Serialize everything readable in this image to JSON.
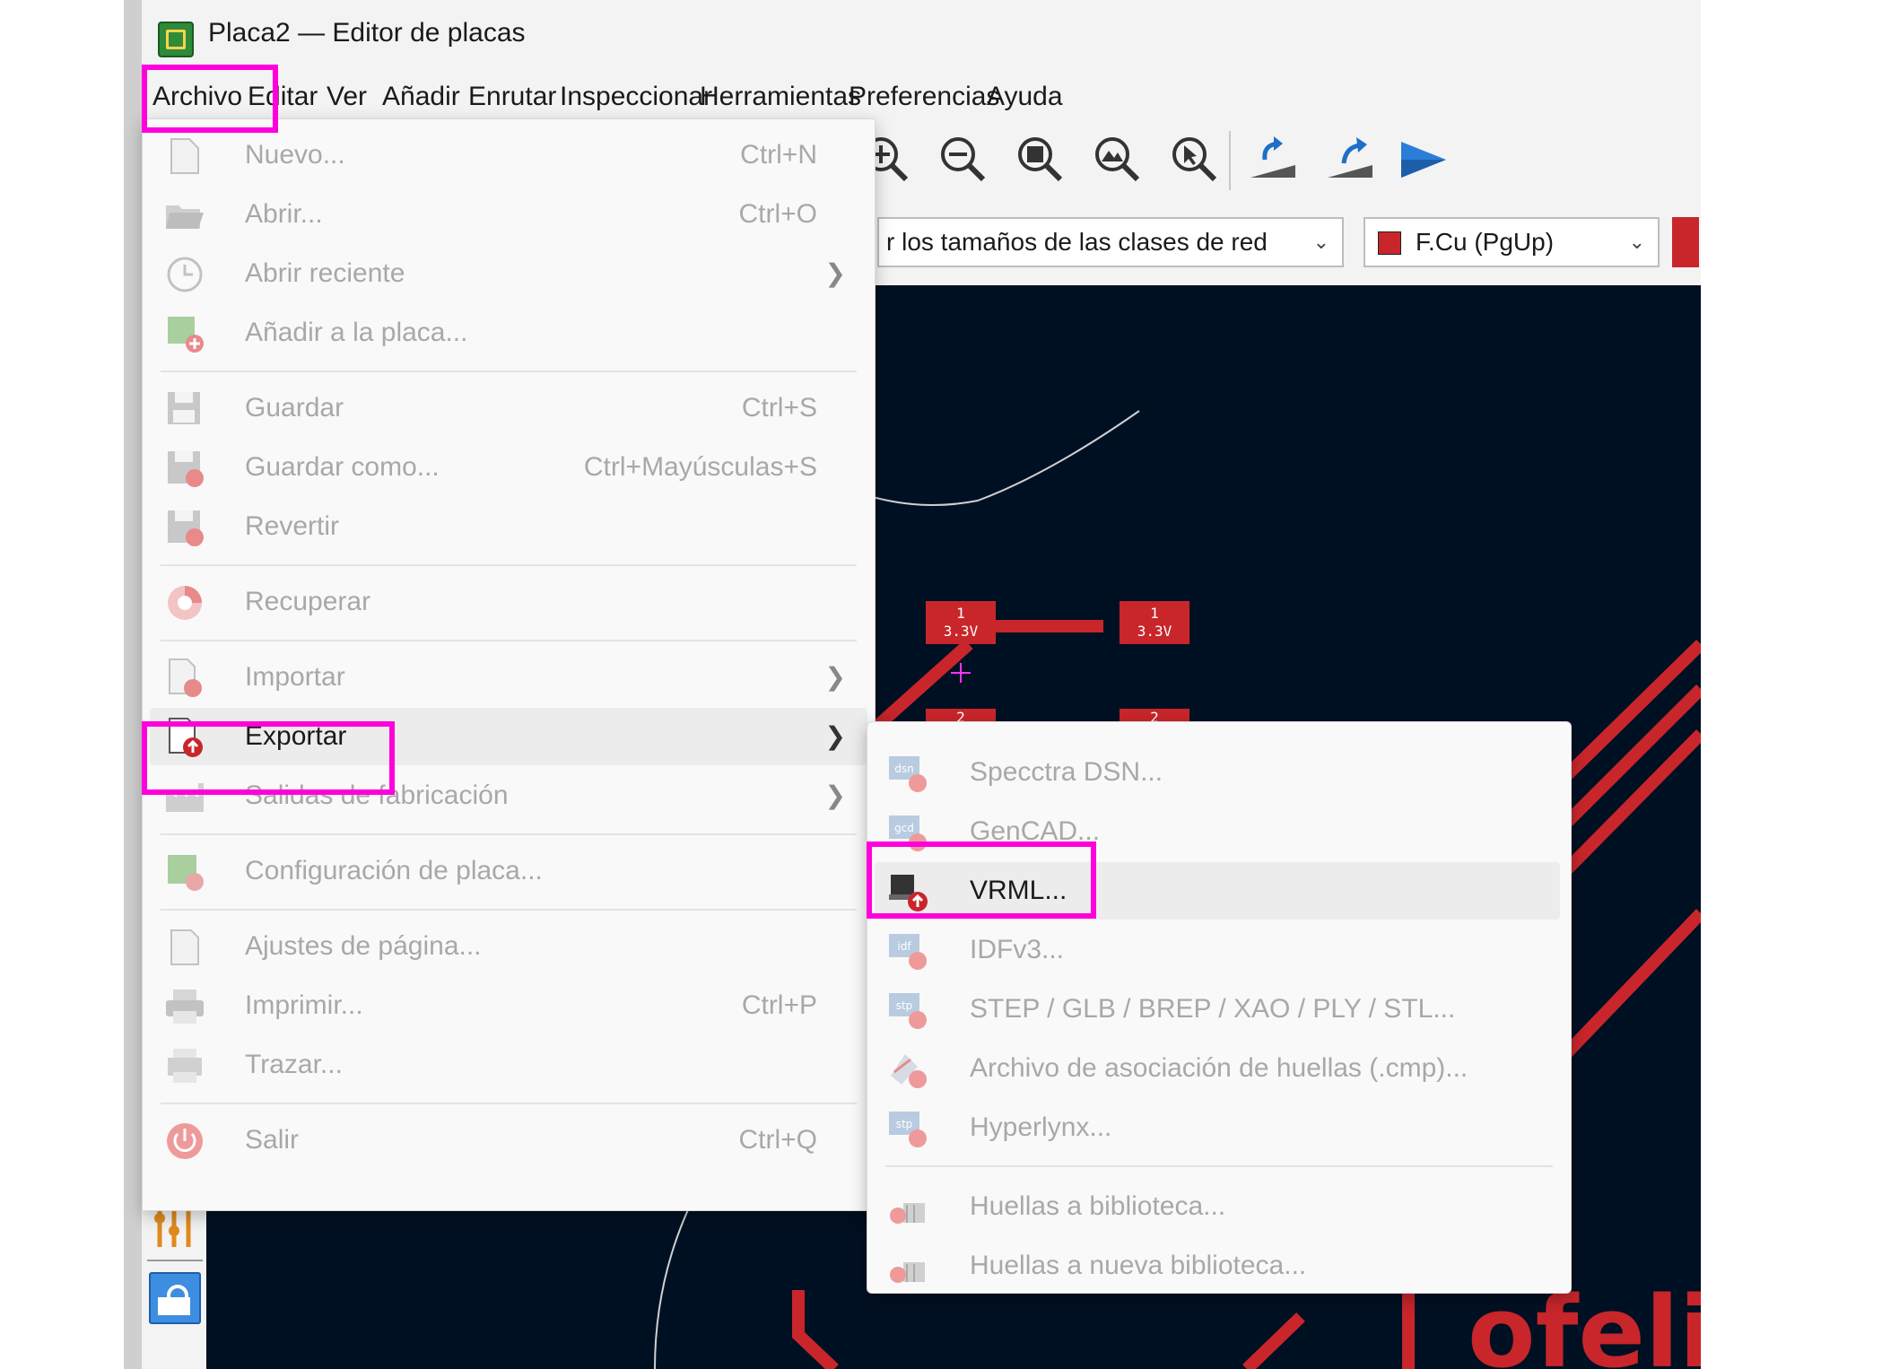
{
  "window": {
    "title": "Placa2 — Editor de placas"
  },
  "menubar": [
    "Archivo",
    "Editar",
    "Ver",
    "Añadir",
    "Enrutar",
    "Inspeccionar",
    "Herramientas",
    "Preferencias",
    "Ayuda"
  ],
  "toolbar": {
    "icons": [
      "find-icon",
      "refresh-icon",
      "zoom-in-icon",
      "zoom-out-icon",
      "zoom-fit-icon",
      "zoom-objects-icon",
      "zoom-selection-icon",
      "flip-board-icon",
      "rotate-icon",
      "play-icon"
    ]
  },
  "combos": {
    "netclass": "r los tamaños de las clases de red",
    "layer": "F.Cu (PgUp)",
    "layer_color": "#c8262b"
  },
  "file_menu": [
    {
      "label": "Nuevo...",
      "shortcut": "Ctrl+N",
      "icon": "new-file-icon",
      "enabled": false
    },
    {
      "label": "Abrir...",
      "shortcut": "Ctrl+O",
      "icon": "folder-icon",
      "enabled": false
    },
    {
      "label": "Abrir reciente",
      "submenu": true,
      "icon": "clock-icon",
      "enabled": false
    },
    {
      "label": "Añadir a la placa...",
      "icon": "add-board-icon",
      "enabled": false
    },
    {
      "label": "Guardar",
      "shortcut": "Ctrl+S",
      "icon": "save-icon",
      "enabled": false
    },
    {
      "label": "Guardar como...",
      "shortcut": "Ctrl+Mayúsculas+S",
      "icon": "save-as-icon",
      "enabled": false
    },
    {
      "label": "Revertir",
      "icon": "revert-icon",
      "enabled": false
    },
    {
      "label": "Recuperar",
      "icon": "recover-icon",
      "enabled": false
    },
    {
      "label": "Importar",
      "submenu": true,
      "icon": "import-icon",
      "enabled": false
    },
    {
      "label": "Exportar",
      "submenu": true,
      "icon": "export-icon",
      "enabled": true
    },
    {
      "label": "Salidas de fabricación",
      "submenu": true,
      "icon": "factory-icon",
      "enabled": false
    },
    {
      "label": "Configuración de placa...",
      "icon": "board-settings-icon",
      "enabled": false
    },
    {
      "label": "Ajustes de página...",
      "icon": "page-settings-icon",
      "enabled": false
    },
    {
      "label": "Imprimir...",
      "shortcut": "Ctrl+P",
      "icon": "print-icon",
      "enabled": false
    },
    {
      "label": "Trazar...",
      "icon": "plot-icon",
      "enabled": false
    },
    {
      "label": "Salir",
      "shortcut": "Ctrl+Q",
      "icon": "power-icon",
      "enabled": false
    }
  ],
  "export_submenu": [
    {
      "label": "Specctra DSN...",
      "icon": "dsn-icon",
      "tag": "dsn",
      "enabled": false
    },
    {
      "label": "GenCAD...",
      "icon": "gencad-icon",
      "tag": "gcd",
      "enabled": false
    },
    {
      "label": "VRML...",
      "icon": "vrml-icon",
      "tag": "",
      "enabled": true
    },
    {
      "label": "IDFv3...",
      "icon": "idf-icon",
      "tag": "idf",
      "enabled": false
    },
    {
      "label": "STEP / GLB / BREP / XAO / PLY / STL...",
      "icon": "step-icon",
      "tag": "stp",
      "enabled": false
    },
    {
      "label": "Archivo de asociación de huellas (.cmp)...",
      "icon": "cmp-icon",
      "tag": "",
      "enabled": false
    },
    {
      "label": "Hyperlynx...",
      "icon": "hyperlynx-icon",
      "tag": "stp",
      "enabled": false
    },
    {
      "label": "Huellas a biblioteca...",
      "icon": "footprint-lib-icon",
      "tag": "",
      "enabled": false
    },
    {
      "label": "Huellas a nueva biblioteca...",
      "icon": "footprint-newlib-icon",
      "tag": "",
      "enabled": false
    }
  ],
  "pcb": {
    "pads": [
      {
        "num": "1",
        "net": "3.3V"
      },
      {
        "num": "1",
        "net": "3.3V"
      },
      {
        "num": "2",
        "net": ""
      },
      {
        "num": "2",
        "net": ""
      }
    ],
    "silkscreen_text": "ofeliA",
    "colors": {
      "background": "#001023",
      "copper": "#c8262b",
      "edge": "#d0d0d0",
      "cursor": "#ff33ff"
    }
  },
  "highlight_color": "#ff00dd"
}
